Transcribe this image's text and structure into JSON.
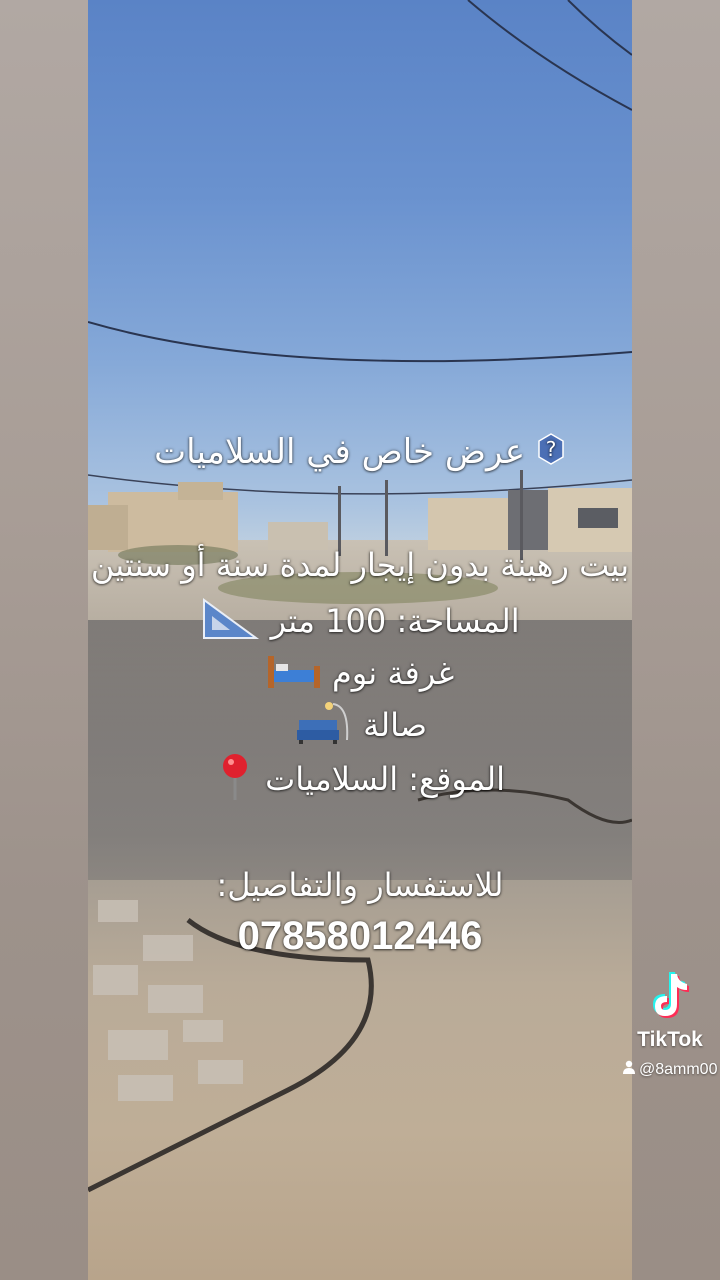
{
  "caption": {
    "title": "عرض خاص في السلاميات",
    "house": "بيت رهينة بدون إيجار لمدة سنة أو سنتين",
    "area": "المساحة: 100 متر",
    "bedroom": "غرفة نوم",
    "hall": "صالة",
    "location": "الموقع: السلاميات",
    "inquiry": "للاستفسار والتفاصيل:",
    "phone": "07858012446"
  },
  "icons": [
    "question-icon",
    "triangle-ruler-icon",
    "bed-icon",
    "sofa-icon",
    "pin-icon",
    "tiktok-logo-icon",
    "user-icon"
  ],
  "watermark": {
    "brand": "TikTok",
    "username": "@8amm00"
  },
  "colors": {
    "sky": "#6a92cf",
    "ground": "#b9ab98",
    "text": "#ffffff"
  }
}
